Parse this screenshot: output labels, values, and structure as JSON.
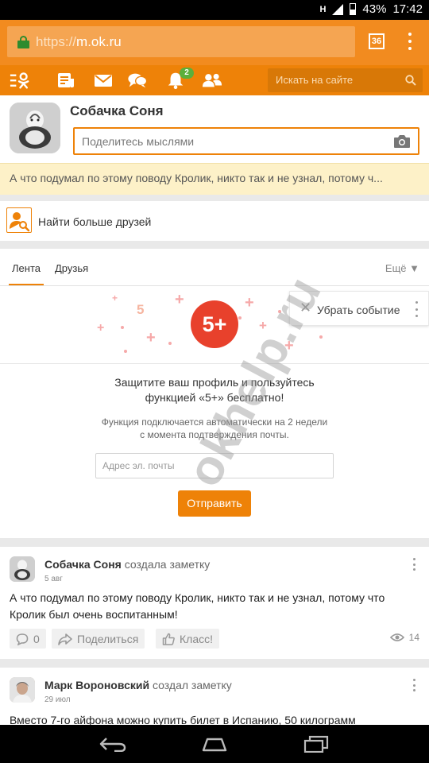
{
  "status_bar": {
    "network": "H",
    "battery": "43%",
    "time": "17:42"
  },
  "browser": {
    "url_scheme": "https://",
    "url_host": "m.ok.ru",
    "tabs_count": "36"
  },
  "nav": {
    "notifications_badge": "2",
    "search_placeholder": "Искать на сайте"
  },
  "profile": {
    "name": "Собачка Соня",
    "thoughts_placeholder": "Поделитесь мыслями"
  },
  "status_strip": {
    "text": "А что подумал по этому поводу Кролик, никто так и не узнал, потому ч..."
  },
  "find_friends": {
    "label": "Найти больше друзей"
  },
  "feed_tabs": {
    "tabs": [
      "Лента",
      "Друзья"
    ],
    "more": "Ещё ▼"
  },
  "promo": {
    "badge": "5+",
    "dismiss_label": "Убрать событие",
    "title_line1": "Защитите ваш профиль и пользуйтесь",
    "title_line2": "функцией «5+» бесплатно!",
    "note_line1": "Функция подключается автоматически на 2 недели",
    "note_line2": "с момента подтверждения почты.",
    "email_placeholder": "Адрес эл. почты",
    "send_label": "Отправить"
  },
  "watermark": "okhelp.ru",
  "posts": [
    {
      "author": "Собачка Соня",
      "action": "создала заметку",
      "date": "5 авг",
      "text": "А что подумал по этому поводу Кролик, никто так и не узнал, потому что Кролик был очень воспитанным!",
      "comments": "0",
      "share_label": "Поделиться",
      "like_label": "Класс!",
      "views": "14"
    },
    {
      "author": "Марк Вороновский",
      "action": "создал заметку",
      "date": "29 июл",
      "text": "Вместо 7-го айфона можно купить билет в Испанию, 50 килограмм"
    }
  ]
}
